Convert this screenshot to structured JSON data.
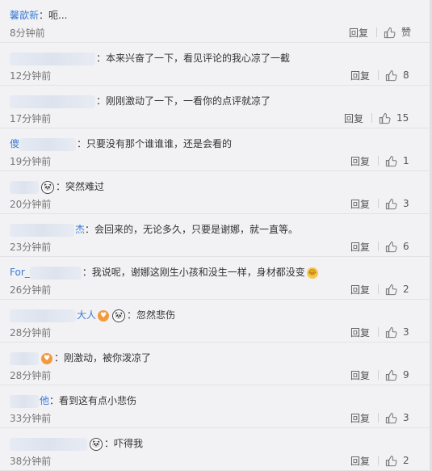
{
  "reply_label": "回复",
  "comments": [
    {
      "user": "馨歆新",
      "text": "：呃...",
      "time": "8分钟前",
      "likes": "赞"
    },
    {
      "user": "",
      "text": "：本来兴奋了一下，看见评论的我心凉了一截",
      "time": "12分钟前",
      "likes": "8"
    },
    {
      "user": "",
      "text": "：刚刚激动了一下，一看你的点评就凉了",
      "time": "17分钟前",
      "likes": "15"
    },
    {
      "user": "傻",
      "text": "：只要没有那个谁谁谁，还是会看的",
      "time": "19分钟前",
      "likes": "1"
    },
    {
      "user": "",
      "text": "：突然难过",
      "time": "20分钟前",
      "likes": "3"
    },
    {
      "user": "杰",
      "text": "：会回来的，无论多久，只要是谢娜，就一直等。",
      "time": "23分钟前",
      "likes": "6"
    },
    {
      "user": "For_",
      "text": "：我说呢，谢娜这刚生小孩和没生一样，身材都没变",
      "time": "26分钟前",
      "likes": "2"
    },
    {
      "user": "大人",
      "text": "：忽然悲伤",
      "time": "28分钟前",
      "likes": "3"
    },
    {
      "user": "",
      "text": "：刚激动，被你泼凉了",
      "time": "28分钟前",
      "likes": "9"
    },
    {
      "user": "他",
      "text": "：看到这有点小悲伤",
      "time": "33分钟前",
      "likes": "3"
    },
    {
      "user": "",
      "text": "：吓得我",
      "time": "38分钟前",
      "likes": "2"
    }
  ]
}
